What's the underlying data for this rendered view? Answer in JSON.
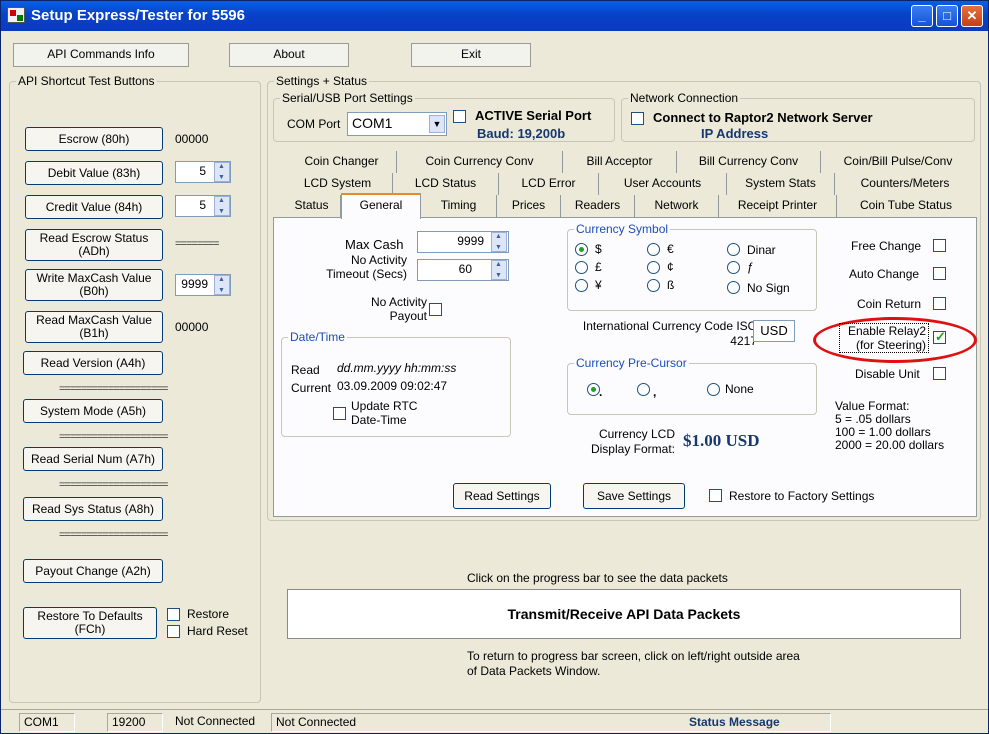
{
  "window": {
    "title": "Setup Express/Tester for 5596"
  },
  "titlebar_buttons": {
    "min": "_",
    "max": "□",
    "close": "✕"
  },
  "menu": {
    "api_info": "API Commands Info",
    "about": "About",
    "exit": "Exit"
  },
  "left": {
    "group_title": "API Shortcut Test Buttons",
    "escrow": "Escrow (80h)",
    "escrow_val": "00000",
    "debit": "Debit Value (83h)",
    "debit_val": "5",
    "credit": "Credit Value (84h)",
    "credit_val": "5",
    "read_escrow": "Read Escrow Status (ADh)",
    "read_escrow_val": "========",
    "write_maxcash": "Write MaxCash Value (B0h)",
    "write_maxcash_val": "9999",
    "read_maxcash": "Read MaxCash Value (B1h)",
    "read_maxcash_val": "00000",
    "read_version": "Read Version (A4h)",
    "separator": "====================",
    "system_mode": "System Mode (A5h)",
    "read_serial": "Read Serial Num (A7h)",
    "read_sys_status": "Read Sys Status (A8h)",
    "payout_change": "Payout Change (A2h)",
    "restore_defaults": "Restore To Defaults (FCh)",
    "restore_label": "Restore",
    "hard_reset_label": "Hard Reset"
  },
  "settings": {
    "group_title": "Settings + Status",
    "serial_group": "Serial/USB Port Settings",
    "com_port_label": "COM Port",
    "com_port_value": "COM1",
    "active_serial": "ACTIVE Serial Port",
    "baud": "Baud: 19,200b",
    "network_group": "Network Connection",
    "connect_raptor": "Connect to Raptor2 Network Server",
    "ip_address": "IP Address"
  },
  "tabs": {
    "row1": [
      "Coin Changer",
      "Coin Currency Conv",
      "Bill Acceptor",
      "Bill Currency Conv",
      "Coin/Bill Pulse/Conv"
    ],
    "row2": [
      "LCD System",
      "LCD Status",
      "LCD Error",
      "User Accounts",
      "System Stats",
      "Counters/Meters"
    ],
    "row3": [
      "Status",
      "General",
      "Timing",
      "Prices",
      "Readers",
      "Network",
      "Receipt Printer",
      "Coin Tube Status"
    ]
  },
  "general": {
    "max_cash_label": "Max Cash",
    "max_cash_value": "9999",
    "no_activity_timeout_label": "No Activity Timeout (Secs)",
    "timeout_value": "60",
    "no_activity_payout_label": "No Activity Payout",
    "datetime_group": "Date/Time",
    "read_label": "Read",
    "read_format": "dd.mm.yyyy hh:mm:ss",
    "current_label": "Current",
    "current_value": "03.09.2009 09:02:47",
    "update_rtc": "Update RTC Date-Time",
    "currency_symbol_group": "Currency Symbol",
    "symbols": [
      "$",
      "€",
      "Dinar",
      "£",
      "¢",
      "ƒ",
      "¥",
      "ß",
      "No Sign"
    ],
    "intl_code_label": "International Currency Code ISO 4217",
    "intl_code_value": "USD",
    "precursor_group": "Currency Pre-Cursor",
    "precursor_opts": [
      ".",
      ",",
      "None"
    ],
    "lcd_format_label": "Currency LCD Display Format:",
    "lcd_format_value": "$1.00 USD",
    "free_change": "Free Change",
    "auto_change": "Auto Change",
    "coin_return": "Coin Return",
    "enable_relay": "Enable Relay2 (for Steering)",
    "disable_unit": "Disable Unit",
    "value_format": "Value Format:",
    "vf1": "5 = .05 dollars",
    "vf2": "100 = 1.00 dollars",
    "vf3": "2000 = 20.00 dollars",
    "read_settings": "Read Settings",
    "save_settings": "Save Settings",
    "restore_factory": "Restore to Factory Settings"
  },
  "packets": {
    "hint": "Click on the progress bar to see the data packets",
    "bar_label": "Transmit/Receive API Data Packets",
    "return_hint": "To return to progress bar screen, click on left/right outside area of Data Packets Window."
  },
  "statusbar": {
    "port": "COM1",
    "baud": "19200",
    "conn1": "Not Connected",
    "conn2": "Not Connected",
    "message": "Status Message"
  },
  "colors": {
    "title_blue": "#0a49d6",
    "highlight_red": "#e01010",
    "baud_blue": "#17386f"
  }
}
